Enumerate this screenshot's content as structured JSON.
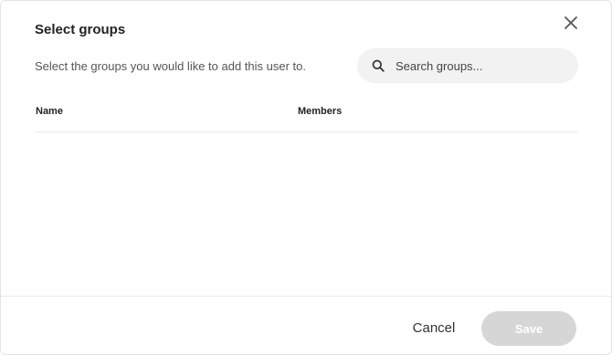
{
  "dialog": {
    "title": "Select groups",
    "subtitle": "Select the groups you would like to add this user to.",
    "close_icon": "close-icon"
  },
  "search": {
    "icon": "search-icon",
    "placeholder": "Search groups...",
    "value": ""
  },
  "table": {
    "columns": [
      "Name",
      "Members"
    ],
    "rows": []
  },
  "footer": {
    "cancel_label": "Cancel",
    "save_label": "Save",
    "save_disabled": true
  },
  "colors": {
    "save_disabled_bg": "#d6d6d6",
    "search_bg": "#f2f2f2"
  }
}
